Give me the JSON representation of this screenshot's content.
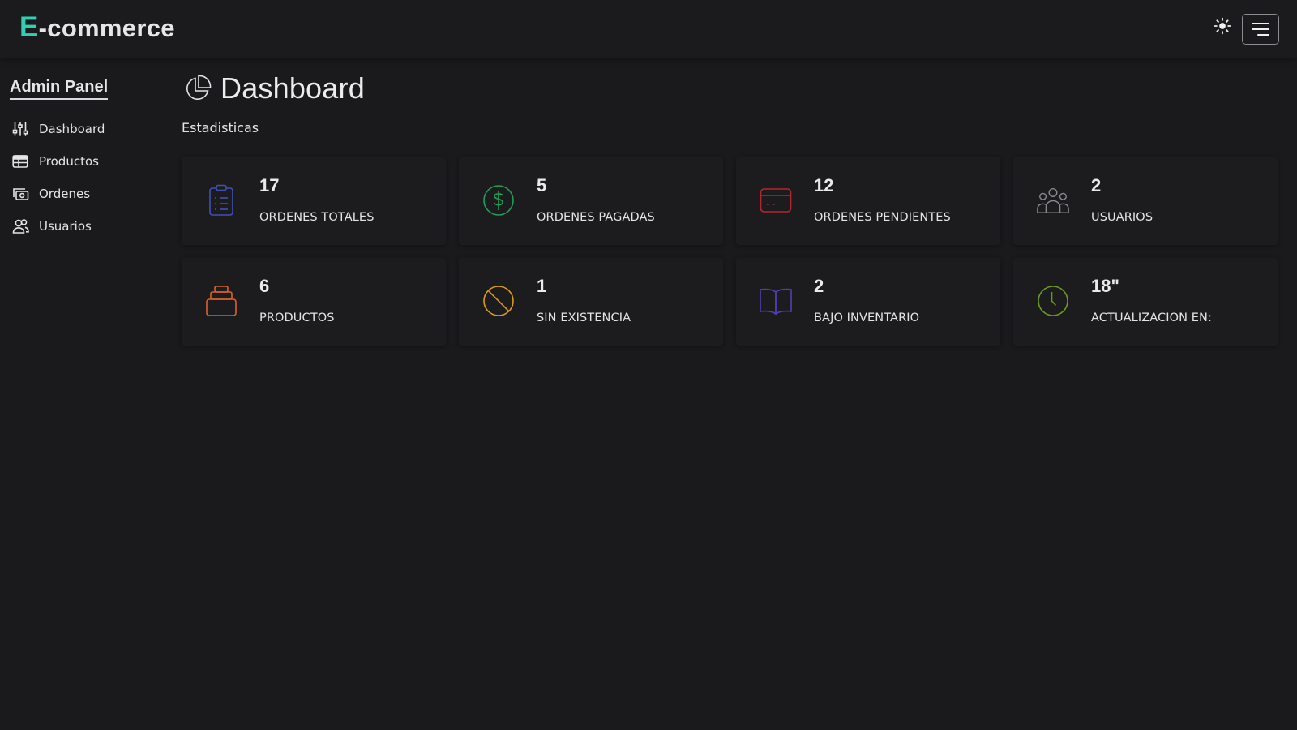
{
  "brand": {
    "accent": "E",
    "rest": "-commerce"
  },
  "header": {
    "theme_icon": "sun-icon",
    "menu_icon": "hamburger-menu-icon"
  },
  "sidebar": {
    "title": "Admin Panel",
    "items": [
      {
        "label": "Dashboard",
        "icon": "sliders-icon"
      },
      {
        "label": "Productos",
        "icon": "table-icon"
      },
      {
        "label": "Ordenes",
        "icon": "cash-stack-icon"
      },
      {
        "label": "Usuarios",
        "icon": "people-icon"
      }
    ]
  },
  "main": {
    "title": "Dashboard",
    "title_icon": "pie-chart-icon",
    "section": "Estadisticas",
    "cards": [
      {
        "value": "17",
        "label": "ORDENES TOTALES",
        "icon": "clipboard-icon",
        "color": "#3f51b5"
      },
      {
        "value": "5",
        "label": "ORDENES PAGADAS",
        "icon": "dollar-circle-icon",
        "color": "#1f9d55"
      },
      {
        "value": "12",
        "label": "ORDENES PENDIENTES",
        "icon": "credit-card-icon",
        "color": "#b3262f"
      },
      {
        "value": "2",
        "label": "USUARIOS",
        "icon": "people-group-icon",
        "color": "#8a8a8e"
      },
      {
        "value": "6",
        "label": "PRODUCTOS",
        "icon": "stack-box-icon",
        "color": "#d9622b"
      },
      {
        "value": "1",
        "label": "SIN EXISTENCIA",
        "icon": "ban-icon",
        "color": "#d99a1c"
      },
      {
        "value": "2",
        "label": "BAJO INVENTARIO",
        "icon": "open-book-icon",
        "color": "#4f3fb0"
      },
      {
        "value": "18\"",
        "label": "ACTUALIZACION EN:",
        "icon": "clock-icon",
        "color": "#6a9a1f"
      }
    ]
  },
  "colors": {
    "background": "#1a1a1d",
    "brand_accent": "#2fd0b4"
  }
}
